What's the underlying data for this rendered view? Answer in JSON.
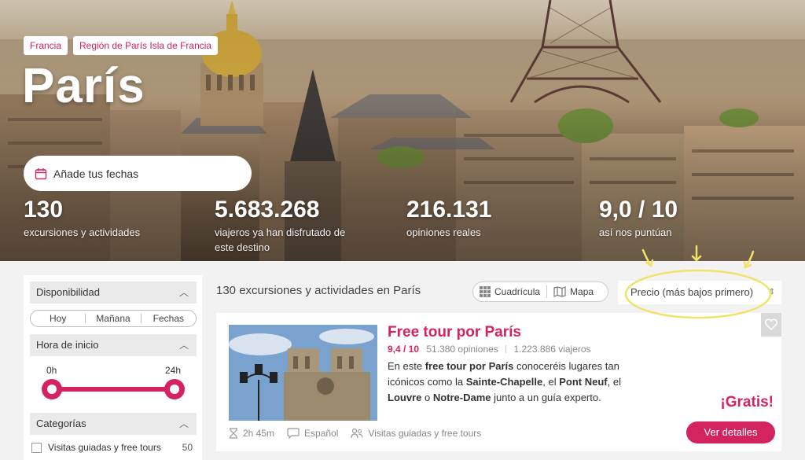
{
  "hero": {
    "breadcrumbs": [
      "Francia",
      "Región de París Isla de Francia"
    ],
    "title": "París",
    "date_placeholder": "Añade tus fechas",
    "stats": [
      {
        "value": "130",
        "label": "excursiones y actividades"
      },
      {
        "value": "5.683.268",
        "label": "viajeros ya han disfrutado de este destino"
      },
      {
        "value": "216.131",
        "label": "opiniones reales"
      },
      {
        "value": "9,0 / 10",
        "label": "así nos puntúan"
      }
    ]
  },
  "sidebar": {
    "availability": {
      "title": "Disponibilidad",
      "options": [
        "Hoy",
        "Mañana",
        "Fechas"
      ]
    },
    "start_time": {
      "title": "Hora de inicio",
      "min_label": "0h",
      "max_label": "24h"
    },
    "categories": {
      "title": "Categorías",
      "items": [
        {
          "label": "Visitas guiadas y free tours",
          "count": "50"
        }
      ]
    }
  },
  "results": {
    "count_text": "130 excursiones y actividades en París",
    "view_grid": "Cuadrícula",
    "view_map": "Mapa",
    "sort_value": "Precio (más bajos primero)"
  },
  "card": {
    "title": "Free tour por París",
    "rating": "9,4 / 10",
    "reviews": "51.380 opiniones",
    "travelers": "1.223.886 viajeros",
    "desc_1": "En este ",
    "desc_b1": "free tour por París",
    "desc_2": " conoceréis lugares tan icónicos como la ",
    "desc_b2": "Sainte-Chapelle",
    "desc_3": ", el ",
    "desc_b3": "Pont Neuf",
    "desc_4": ", el ",
    "desc_b4": "Louvre",
    "desc_5": " o ",
    "desc_b5": "Notre-Dame",
    "desc_6": " junto a un guía experto.",
    "price": "¡Gratis!",
    "cta": "Ver detalles",
    "duration": "2h 45m",
    "language": "Español",
    "category": "Visitas guiadas y free tours"
  },
  "colors": {
    "accent": "#d3245f",
    "annotation": "#f1e26a"
  },
  "icons": [
    "calendar-icon",
    "chevron-up-icon",
    "grid-icon",
    "map-icon",
    "sort-updown-icon",
    "heart-icon",
    "hourglass-icon",
    "speech-bubble-icon",
    "people-icon"
  ]
}
